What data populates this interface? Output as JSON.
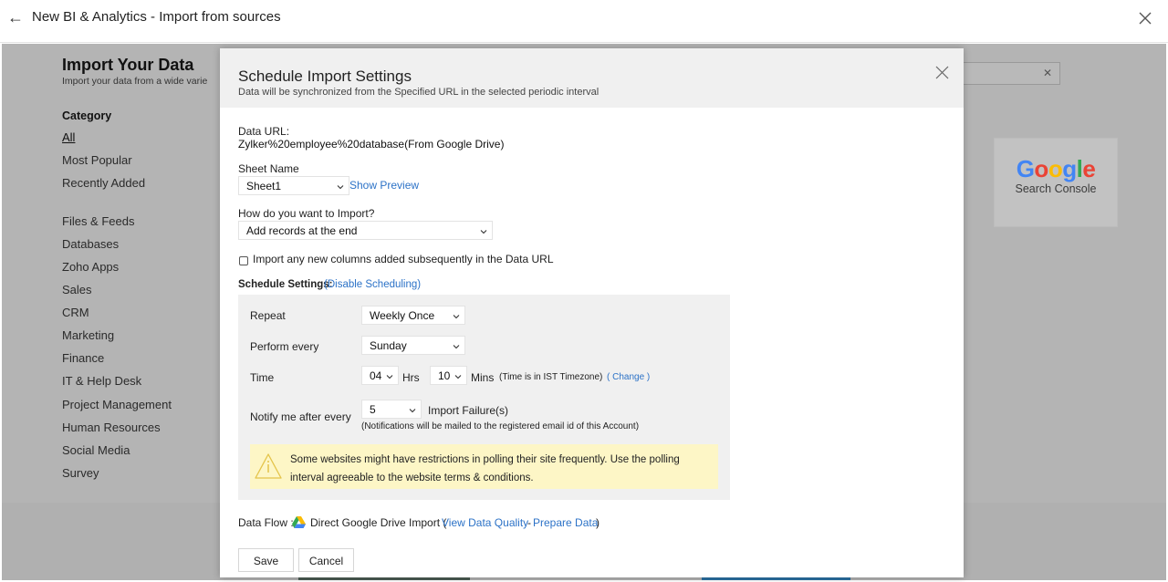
{
  "topbar": {
    "title": "New BI & Analytics - Import from sources"
  },
  "background": {
    "heading": "Import Your Data",
    "subheading": "Import your data from a wide varie",
    "category_title": "Category",
    "categories": [
      "All",
      "Most Popular",
      "Recently Added",
      "Files & Feeds",
      "Databases",
      "Zoho Apps",
      "Sales",
      "CRM",
      "Marketing",
      "Finance",
      "IT & Help Desk",
      "Project Management",
      "Human Resources",
      "Social Media",
      "Survey"
    ],
    "google_card": {
      "logo_letters": [
        "G",
        "o",
        "o",
        "g",
        "l",
        "e"
      ],
      "logo_colors": [
        "#4285F4",
        "#EA4335",
        "#FBBC05",
        "#4285F4",
        "#34A853",
        "#EA4335"
      ],
      "subtitle": "Search Console"
    }
  },
  "modal": {
    "title": "Schedule Import Settings",
    "description": "Data will be synchronized from the Specified URL in the selected periodic interval",
    "data_url_label": "Data URL:",
    "data_url_value": "Zylker%20employee%20database(From Google Drive)",
    "sheet_name_label": "Sheet Name",
    "sheet_name_value": "Sheet1",
    "show_preview": "Show Preview",
    "import_how_label": "How do you want to Import?",
    "import_how_value": "Add records at the end",
    "new_columns_checkbox_label": "Import any new columns added subsequently in the Data URL",
    "new_columns_checked": false,
    "schedule_label": "Schedule Settings:",
    "disable_scheduling": "(Disable Scheduling)",
    "schedule": {
      "repeat_label": "Repeat",
      "repeat_value": "Weekly Once",
      "perform_label": "Perform every",
      "perform_value": "Sunday",
      "time_label": "Time",
      "hours_value": "04",
      "hrs_label": "Hrs",
      "minutes_value": "10",
      "mins_label": "Mins",
      "timezone_note": "(Time is in IST Timezone)",
      "change_link": "( Change )",
      "notify_label": "Notify me after every",
      "notify_value": "5",
      "import_failure_label": "Import Failure(s)",
      "notify_note": "(Notifications will be mailed to the registered email id of this Account)",
      "warning_text": "Some websites might have restrictions in polling their site frequently. Use the polling interval agreeable to the website terms & conditions."
    },
    "data_flow_label": "Data Flow :",
    "data_flow_text": "Direct Google Drive Import (",
    "view_data_quality": "View Data Quality",
    "dash": "-",
    "prepare_data": "Prepare Data",
    "close_paren": ")",
    "save_label": "Save",
    "cancel_label": "Cancel"
  }
}
